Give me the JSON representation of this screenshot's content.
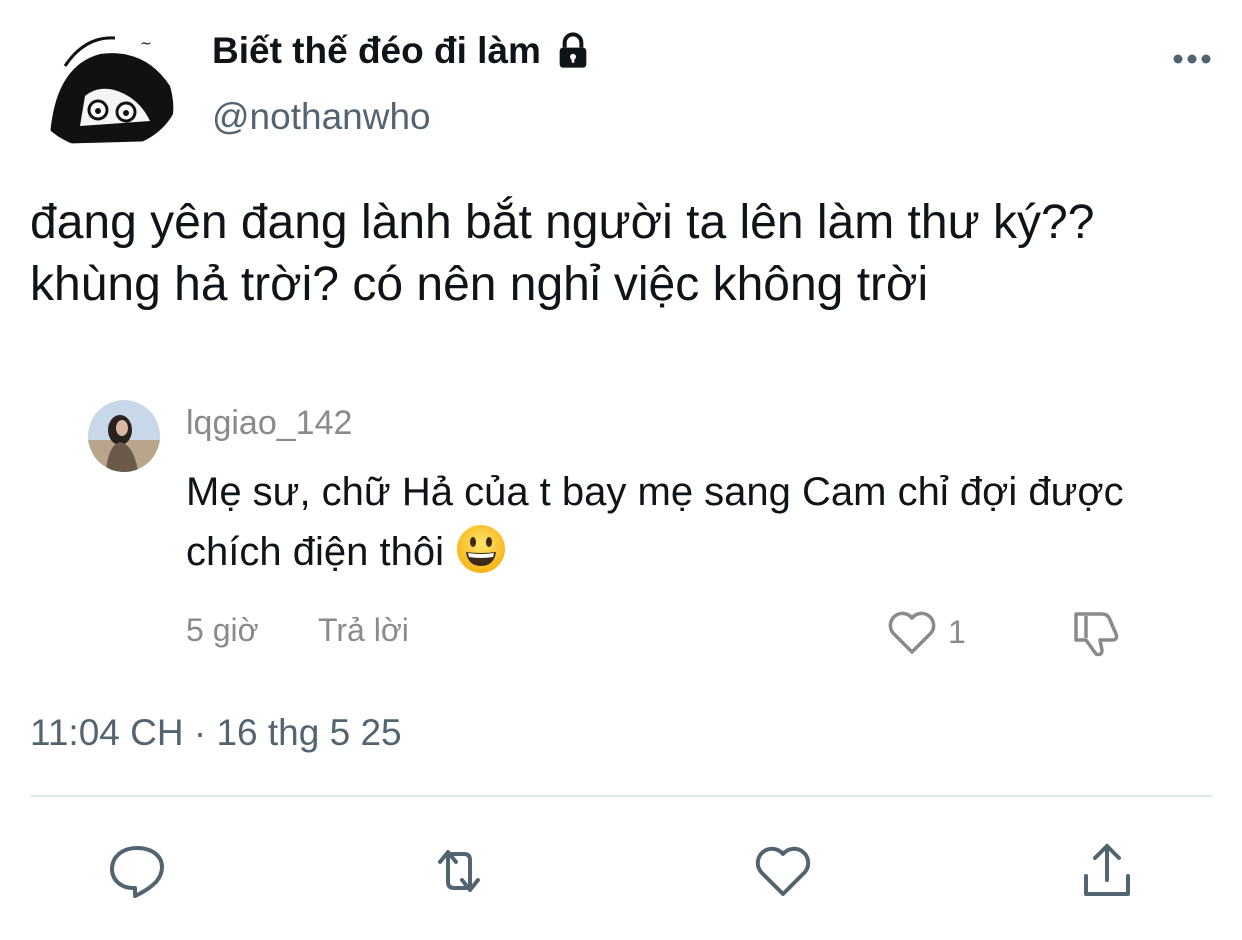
{
  "tweet": {
    "display_name": "Biết thế đéo đi làm",
    "handle": "@nothanwho",
    "text": "đang yên đang lành bắt người ta lên làm thư ký?? khùng hả trời? có nên nghỉ việc không trời",
    "timestamp": "11:04 CH · 16 thg 5 25"
  },
  "icons": {
    "avatar": "cartoon-avatar",
    "lock": "lock-icon",
    "more": "more-icon",
    "reply": "reply-icon",
    "retweet": "retweet-icon",
    "like": "heart-icon",
    "share": "share-icon"
  },
  "comment": {
    "username": "lqgiao_142",
    "text": "Mẹ sư, chữ Hả của t bay mẹ sang Cam chỉ đợi được chích điện thôi",
    "emoji": "grinning-face-emoji",
    "time": "5 giờ",
    "reply_label": "Trả lời",
    "like_count": "1"
  },
  "colors": {
    "text": "#0f1419",
    "secondary": "#536471",
    "comment_meta": "#8a8a8a",
    "divider": "#e1e8ed"
  }
}
